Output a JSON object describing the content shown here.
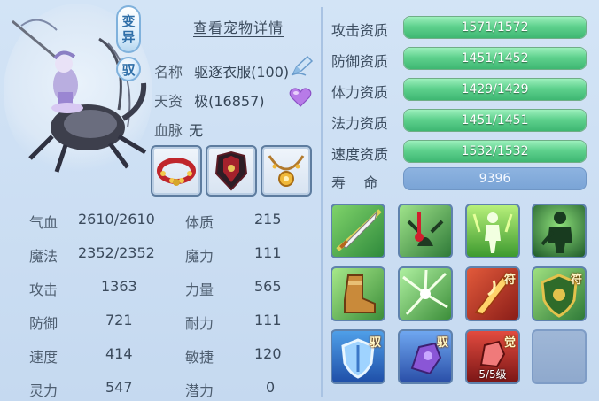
{
  "pet": {
    "variant_badge": [
      "变",
      "异"
    ],
    "drive_badge": "驭",
    "details_link": "查看宠物详情",
    "name_label": "名称",
    "name_value": "驱逐衣服(100)",
    "talent_label": "天资",
    "talent_value": "极(16857)",
    "bloodline_label": "血脉",
    "bloodline_value": "无"
  },
  "stats": [
    {
      "label": "气血",
      "value": "2610/2610"
    },
    {
      "label": "魔法",
      "value": "2352/2352"
    },
    {
      "label": "攻击",
      "value": "1363"
    },
    {
      "label": "防御",
      "value": "721"
    },
    {
      "label": "速度",
      "value": "414"
    },
    {
      "label": "灵力",
      "value": "547"
    }
  ],
  "attributes": [
    {
      "label": "体质",
      "value": "215"
    },
    {
      "label": "魔力",
      "value": "111"
    },
    {
      "label": "力量",
      "value": "565"
    },
    {
      "label": "耐力",
      "value": "111"
    },
    {
      "label": "敏捷",
      "value": "120"
    },
    {
      "label": "潜力",
      "value": "0"
    }
  ],
  "aptitudes": [
    {
      "label": "攻击资质",
      "value": "1571/1572",
      "fill": 1.0
    },
    {
      "label": "防御资质",
      "value": "1451/1452",
      "fill": 1.0
    },
    {
      "label": "体力资质",
      "value": "1429/1429",
      "fill": 1.0
    },
    {
      "label": "法力资质",
      "value": "1451/1451",
      "fill": 1.0
    },
    {
      "label": "速度资质",
      "value": "1532/1532",
      "fill": 1.0
    }
  ],
  "life": {
    "label": "寿    命",
    "value": "9396"
  },
  "skills": {
    "tag_talisman": "符",
    "tag_drive": "驭",
    "tag_awaken": "觉",
    "awaken_level": "5/5级"
  },
  "colors": {
    "bar_green": "#5fd18e",
    "panel_bg": "#c9dcf2"
  }
}
